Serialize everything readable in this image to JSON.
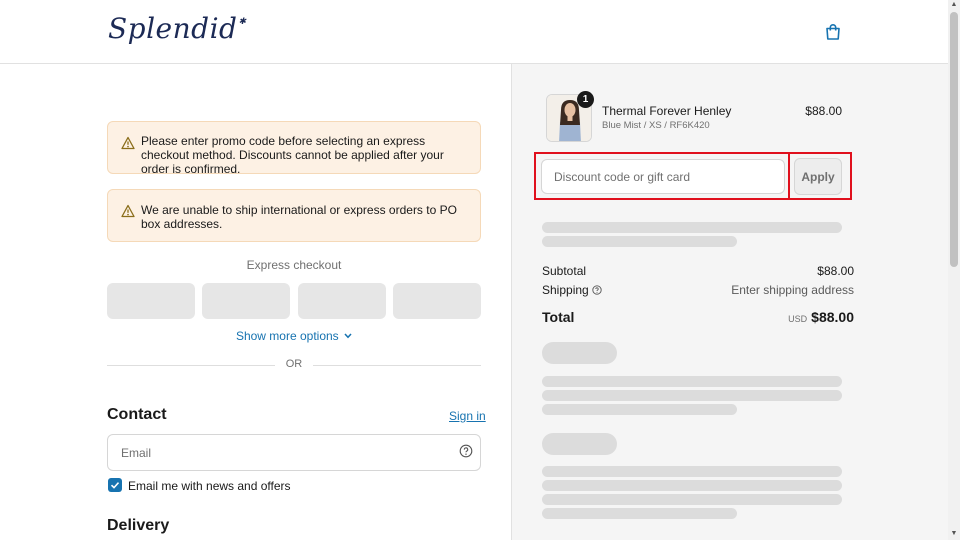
{
  "header": {
    "logo_text": "Splendid",
    "cart_icon": "shopping-bag-icon"
  },
  "alerts": [
    {
      "icon": "warning-icon",
      "text": "Please enter promo code before selecting an express checkout method. Discounts cannot be applied after your order is confirmed."
    },
    {
      "icon": "warning-icon",
      "text": "We are unable to ship international or express orders to PO box addresses."
    }
  ],
  "express": {
    "label": "Express checkout",
    "show_more": "Show more options",
    "or": "OR"
  },
  "contact": {
    "title": "Contact",
    "sign_in": "Sign in",
    "email_placeholder": "Email",
    "email_value": "",
    "newsletter_label": "Email me with news and offers",
    "newsletter_checked": true
  },
  "delivery": {
    "title": "Delivery"
  },
  "order": {
    "product": {
      "name": "Thermal Forever Henley",
      "variant": "Blue Mist / XS / RF6K420",
      "price": "$88.00",
      "quantity": "1"
    },
    "discount": {
      "placeholder": "Discount code or gift card",
      "value": "",
      "apply_label": "Apply"
    },
    "summary": {
      "subtotal_label": "Subtotal",
      "subtotal_value": "$88.00",
      "shipping_label": "Shipping",
      "shipping_value": "Enter shipping address",
      "total_label": "Total",
      "currency": "USD",
      "total_value": "$88.00"
    }
  },
  "colors": {
    "accent": "#1773b0",
    "alert_bg": "#fdf1e4",
    "highlight": "#e0101d"
  }
}
